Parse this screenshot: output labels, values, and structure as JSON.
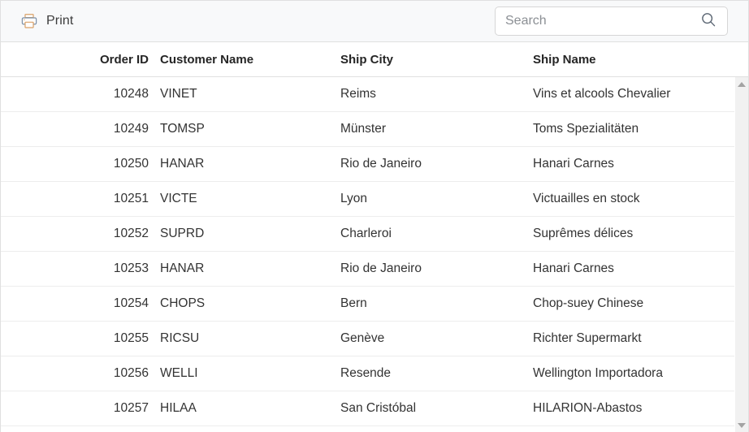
{
  "toolbar": {
    "print_label": "Print",
    "print_icon": "printer-icon",
    "search": {
      "placeholder": "Search",
      "value": "",
      "icon": "search-icon"
    }
  },
  "grid": {
    "columns": [
      {
        "key": "order_id",
        "label": "Order ID",
        "align": "right"
      },
      {
        "key": "customer_name",
        "label": "Customer Name",
        "align": "left"
      },
      {
        "key": "ship_city",
        "label": "Ship City",
        "align": "left"
      },
      {
        "key": "ship_name",
        "label": "Ship Name",
        "align": "left"
      }
    ],
    "rows": [
      {
        "order_id": "10248",
        "customer_name": "VINET",
        "ship_city": "Reims",
        "ship_name": "Vins et alcools Chevalier"
      },
      {
        "order_id": "10249",
        "customer_name": "TOMSP",
        "ship_city": "Münster",
        "ship_name": "Toms Spezialitäten"
      },
      {
        "order_id": "10250",
        "customer_name": "HANAR",
        "ship_city": "Rio de Janeiro",
        "ship_name": "Hanari Carnes"
      },
      {
        "order_id": "10251",
        "customer_name": "VICTE",
        "ship_city": "Lyon",
        "ship_name": "Victuailles en stock"
      },
      {
        "order_id": "10252",
        "customer_name": "SUPRD",
        "ship_city": "Charleroi",
        "ship_name": "Suprêmes délices"
      },
      {
        "order_id": "10253",
        "customer_name": "HANAR",
        "ship_city": "Rio de Janeiro",
        "ship_name": "Hanari Carnes"
      },
      {
        "order_id": "10254",
        "customer_name": "CHOPS",
        "ship_city": "Bern",
        "ship_name": "Chop-suey Chinese"
      },
      {
        "order_id": "10255",
        "customer_name": "RICSU",
        "ship_city": "Genève",
        "ship_name": "Richter Supermarkt"
      },
      {
        "order_id": "10256",
        "customer_name": "WELLI",
        "ship_city": "Resende",
        "ship_name": "Wellington Importadora"
      },
      {
        "order_id": "10257",
        "customer_name": "HILAA",
        "ship_city": "San Cristóbal",
        "ship_name": "HILARION-Abastos"
      }
    ],
    "scrollbar": {
      "up_icon": "scroll-up-arrow-icon",
      "down_icon": "scroll-down-arrow-icon"
    }
  },
  "colors": {
    "toolbar_bg": "#f8f9fa",
    "border": "#e0e0e0",
    "row_separator": "#ededed",
    "text": "#333333",
    "header_text": "#252525",
    "placeholder": "#8b8f94",
    "icon_body": "#7a8fa6",
    "icon_accent": "#d9a066",
    "scroll_track": "#f1f1f1",
    "scroll_arrow": "#a3a3a3"
  }
}
